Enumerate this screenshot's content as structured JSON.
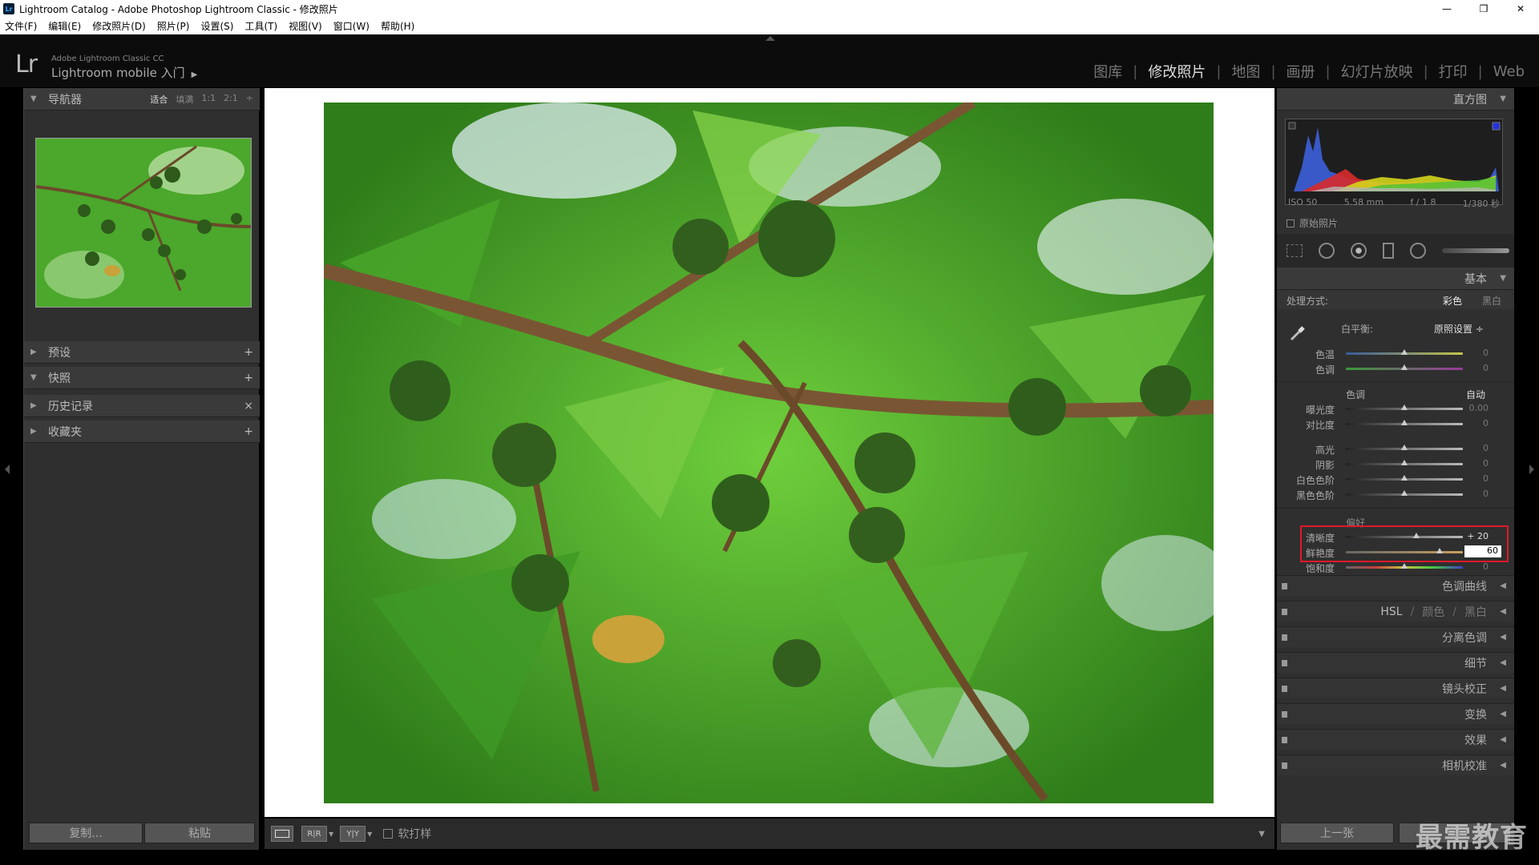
{
  "window": {
    "title": "Lightroom Catalog - Adobe Photoshop Lightroom Classic - 修改照片",
    "icon": "Lr",
    "controls": [
      "—",
      "❐",
      "✕"
    ]
  },
  "menu": [
    "文件(F)",
    "编辑(E)",
    "修改照片(D)",
    "照片(P)",
    "设置(S)",
    "工具(T)",
    "视图(V)",
    "窗口(W)",
    "帮助(H)"
  ],
  "header": {
    "logo": "Lr",
    "brand_small": "Adobe Lightroom Classic CC",
    "brand_main": "Lightroom mobile 入门",
    "brand_arrow": "▶",
    "modules": [
      {
        "label": "图库",
        "active": false
      },
      {
        "label": "修改照片",
        "active": true
      },
      {
        "label": "地图",
        "active": false
      },
      {
        "label": "画册",
        "active": false
      },
      {
        "label": "幻灯片放映",
        "active": false
      },
      {
        "label": "打印",
        "active": false
      },
      {
        "label": "Web",
        "active": false
      }
    ],
    "separator": "|"
  },
  "left": {
    "navigator": {
      "title": "导航器",
      "options": [
        "适合",
        "填满",
        "1:1",
        "2:1"
      ],
      "selected": "适合",
      "more": "÷"
    },
    "panels": [
      {
        "title": "预设",
        "action": "+",
        "open": false
      },
      {
        "title": "快照",
        "action": "+",
        "open": true
      },
      {
        "title": "历史记录",
        "action": "×",
        "open": false
      },
      {
        "title": "收藏夹",
        "action": "+",
        "open": false
      }
    ],
    "copy_button": "复制...",
    "paste_button": "粘贴"
  },
  "toolbar": {
    "view_loupe": "",
    "view_compare": "R|R",
    "view_before_after": "Y|Y",
    "softproof_label": "软打样",
    "menu_arrow": "▼"
  },
  "right": {
    "histogram_title": "直方图",
    "exif": {
      "iso": "ISO 50",
      "focal": "5.58 mm",
      "aperture": "f / 1.8",
      "shutter": "1/380 秒"
    },
    "original_photo_label": "原始照片",
    "basic": {
      "title": "基本",
      "treatment_label": "处理方式:",
      "treatment_color": "彩色",
      "treatment_bw": "黑白",
      "wb_label": "白平衡:",
      "wb_value": "原照设置 ÷",
      "temp_label": "色温",
      "temp_value": "0",
      "temp_pos": 0.5,
      "tint_label": "色调",
      "tint_value": "0",
      "tint_pos": 0.5,
      "tone_label": "色调",
      "auto_label": "自动",
      "exposure_label": "曝光度",
      "exposure_value": "0.00",
      "exposure_pos": 0.5,
      "contrast_label": "对比度",
      "contrast_value": "0",
      "contrast_pos": 0.5,
      "highlights_label": "高光",
      "highlights_value": "0",
      "highlights_pos": 0.5,
      "shadows_label": "阴影",
      "shadows_value": "0",
      "shadows_pos": 0.5,
      "whites_label": "白色色阶",
      "whites_value": "0",
      "whites_pos": 0.5,
      "blacks_label": "黑色色阶",
      "blacks_value": "0",
      "blacks_pos": 0.5,
      "presence_label": "偏好",
      "clarity_label": "清晰度",
      "clarity_value": "+ 20",
      "clarity_pos": 0.6,
      "vibrance_label": "鲜艳度",
      "vibrance_value": "60",
      "vibrance_pos": 0.8,
      "saturation_label": "饱和度",
      "saturation_value": "0",
      "saturation_pos": 0.5
    },
    "collapsed_panels": [
      "色调曲线",
      "细节",
      "镜头校正",
      "变换",
      "效果",
      "相机校准"
    ],
    "hsl": {
      "hsl": "HSL",
      "color": "颜色",
      "bw": "黑白",
      "sep": "/"
    },
    "prev_button": "上一张",
    "watermark": "最需教育"
  },
  "colors": {
    "highlight_box": "#e0182a",
    "panel_bg": "#2f2f2f",
    "header_bg": "#3a3a3a"
  }
}
